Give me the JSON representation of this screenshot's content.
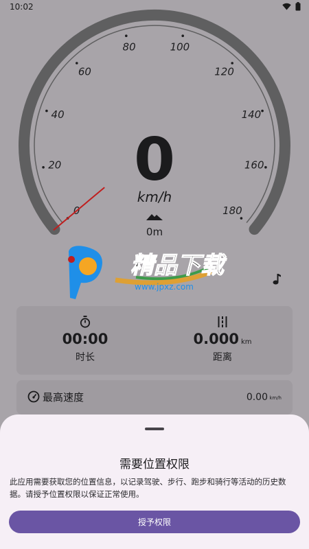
{
  "status_bar": {
    "time": "10:02",
    "icons": [
      "wifi-icon",
      "battery-icon"
    ]
  },
  "speedometer": {
    "speed": "0",
    "unit": "km/h",
    "altitude": "0m",
    "min": 0,
    "max": 180,
    "needle_value": 0,
    "tick_labels": [
      "0",
      "20",
      "40",
      "60",
      "80",
      "100",
      "120",
      "140",
      "160",
      "180"
    ],
    "colors": {
      "arc": "#5f5f60",
      "needle": "#c01e1e"
    }
  },
  "watermark": {
    "text": "精品下载",
    "url": "www.jpxz.com"
  },
  "stats": {
    "duration": {
      "value": "00:00",
      "label": "时长"
    },
    "distance": {
      "value": "0.000",
      "unit": "km",
      "label": "距离"
    }
  },
  "max_speed": {
    "label": "最高速度",
    "value": "0.00",
    "unit": "km/h"
  },
  "permission_sheet": {
    "title": "需要位置权限",
    "body": "此应用需要获取您的位置信息，以记录驾驶、步行、跑步和骑行等活动的历史数据。请授予位置权限以保证正常使用。",
    "button_label": "授予权限",
    "colors": {
      "button": "#6a55a4",
      "sheet": "#f6eff6"
    }
  }
}
